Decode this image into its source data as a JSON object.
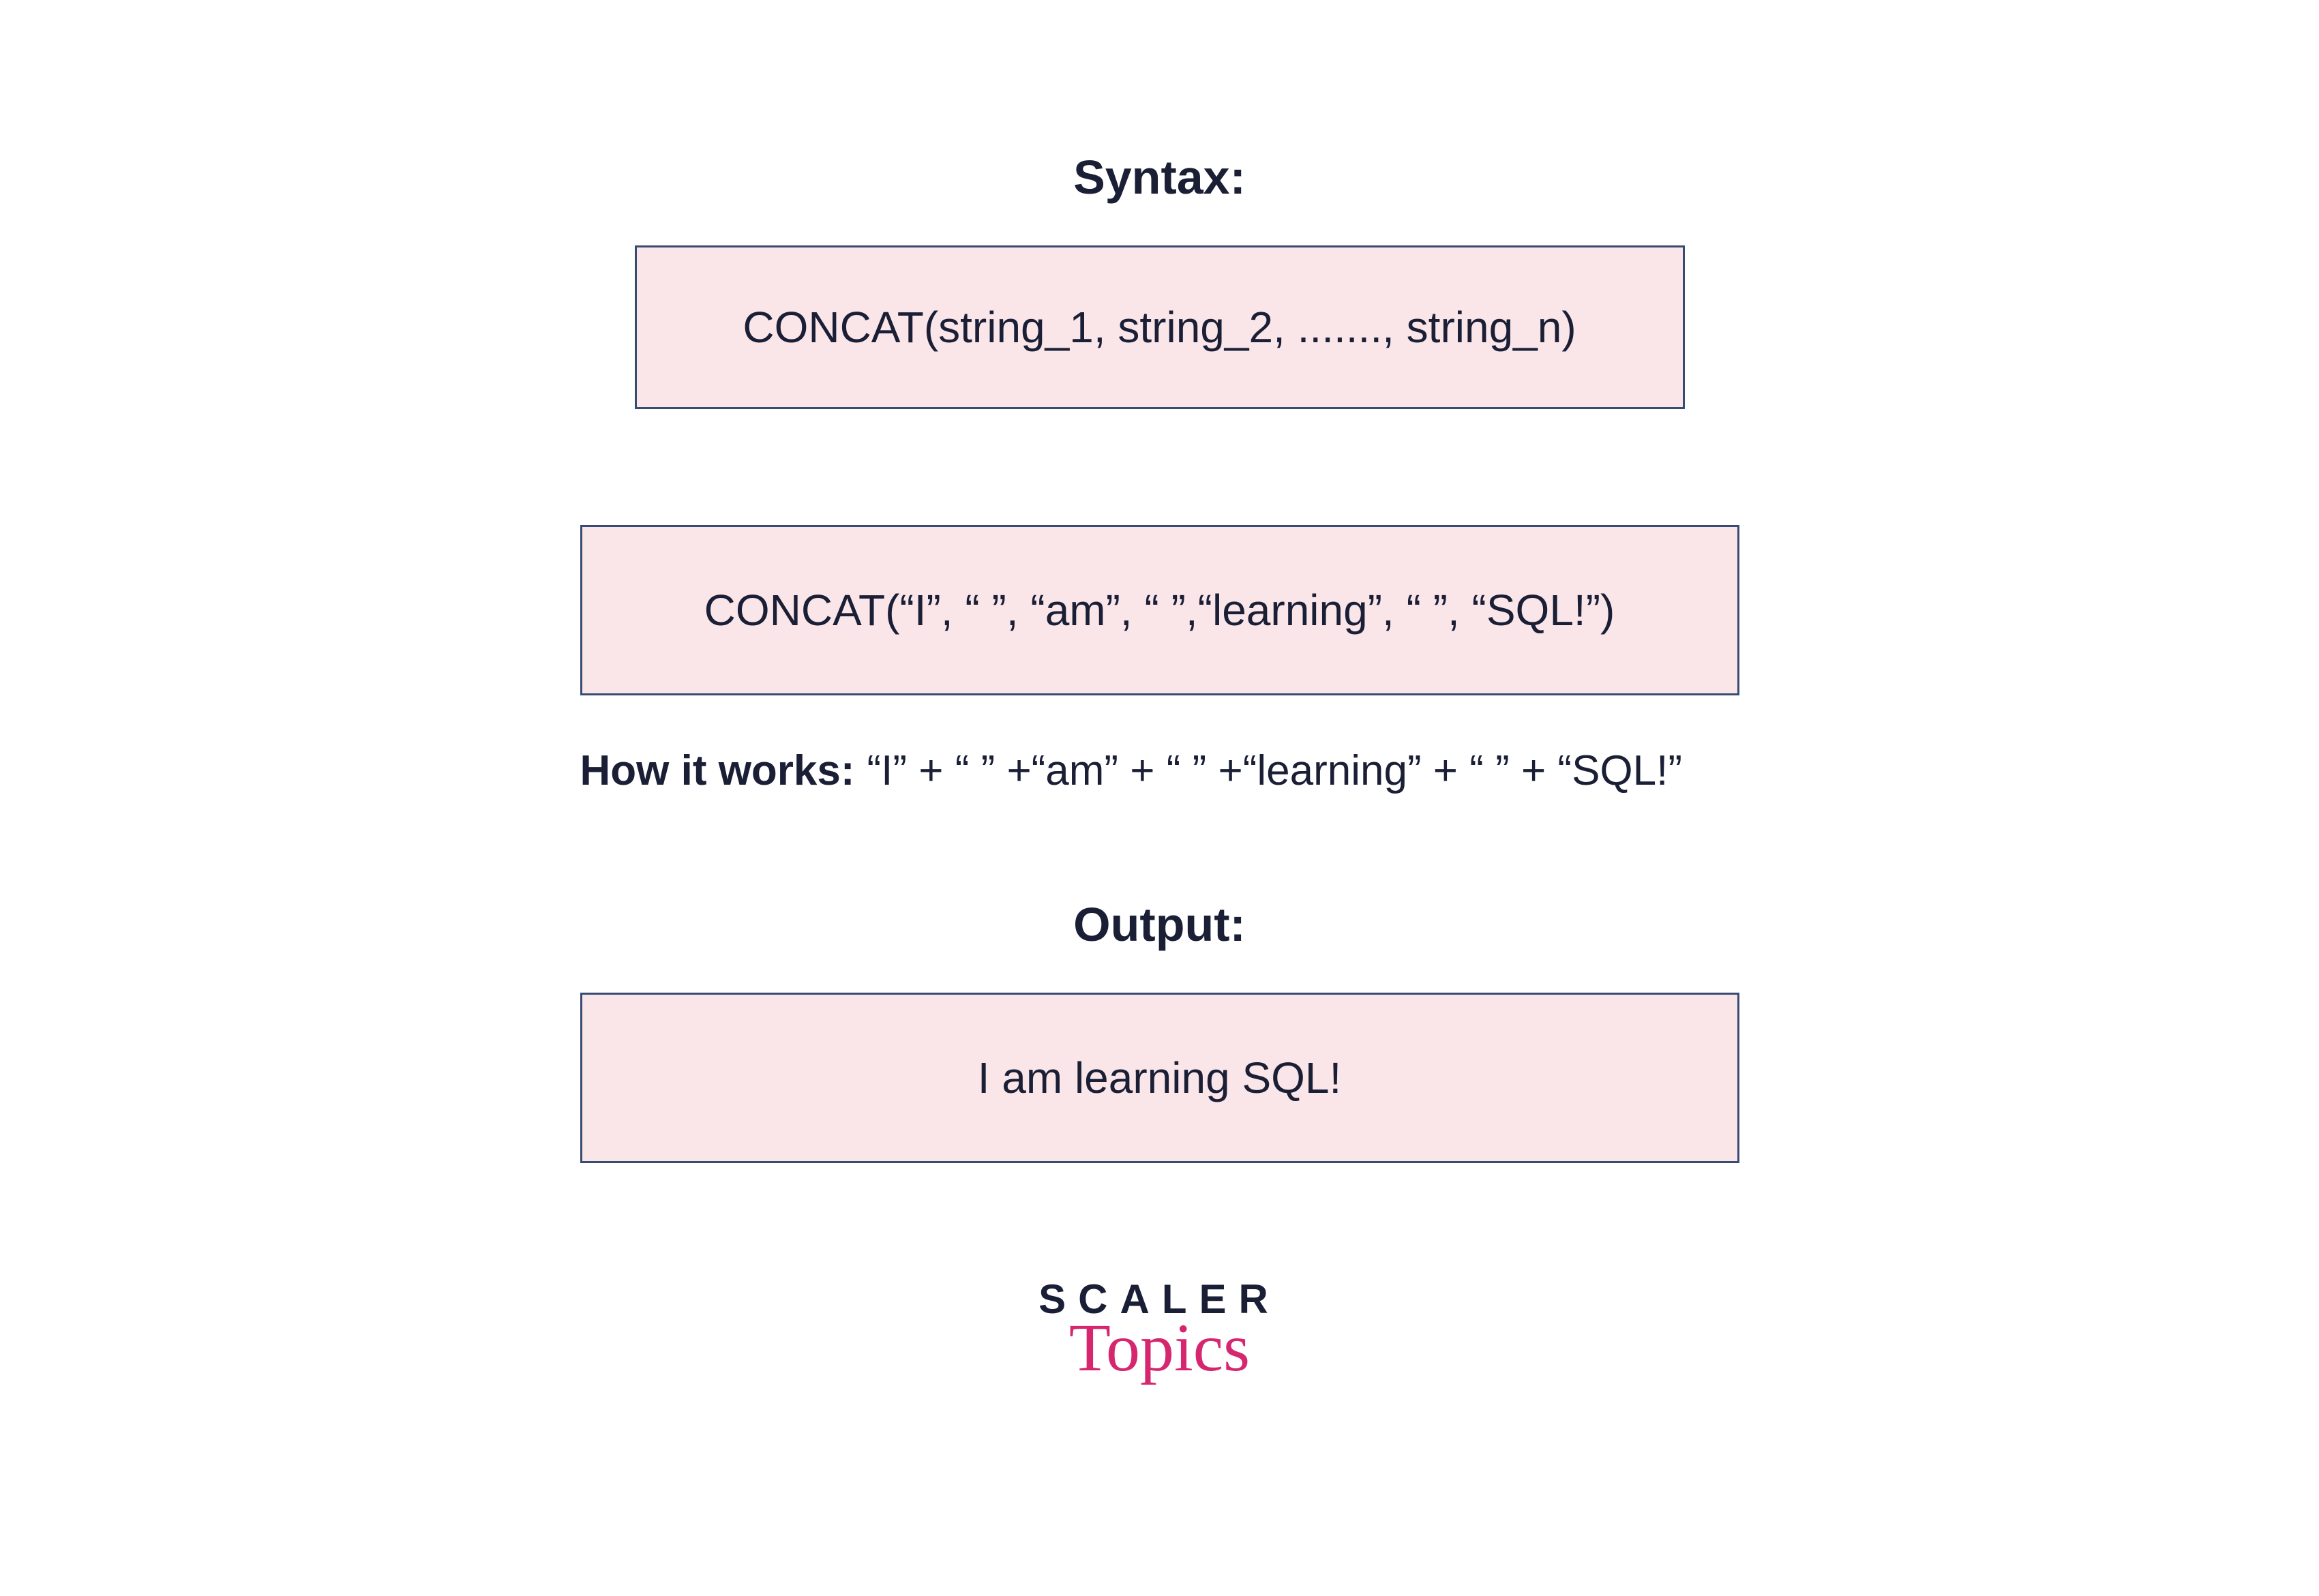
{
  "syntax": {
    "heading": "Syntax:",
    "code": "CONCAT(string_1, string_2, ......., string_n)"
  },
  "example": {
    "code": "CONCAT(“I”, “ ”, “am”, “ ”,“learning”, “ ”, “SQL!”)"
  },
  "how_it_works": {
    "label": "How it works:",
    "expression": "“I” + “ ” +“am” + “ ” +“learning” + “ ” + “SQL!”"
  },
  "output": {
    "heading": "Output:",
    "result": "I am learning SQL!"
  },
  "logo": {
    "top": "SCALER",
    "bottom": "Topics"
  }
}
